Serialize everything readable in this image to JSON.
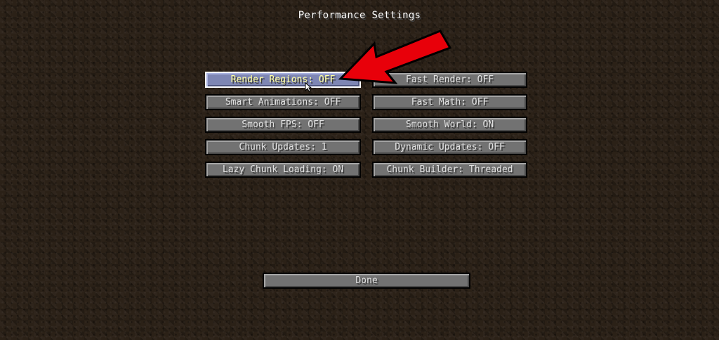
{
  "screen": {
    "title": "Performance Settings"
  },
  "options": {
    "render_regions": "Render Regions: OFF",
    "fast_render": "Fast Render: OFF",
    "smart_animations": "Smart Animations: OFF",
    "fast_math": "Fast Math: OFF",
    "smooth_fps": "Smooth FPS: OFF",
    "smooth_world": "Smooth World: ON",
    "chunk_updates": "Chunk Updates: 1",
    "dynamic_updates": "Dynamic Updates: OFF",
    "lazy_chunk_loading": "Lazy Chunk Loading: ON",
    "chunk_builder": "Chunk Builder: Threaded"
  },
  "footer": {
    "done_label": "Done"
  },
  "annotation": {
    "arrow_color": "#e8000a",
    "icon": "arrow-annotation-icon"
  },
  "colors": {
    "button_face": "#727272",
    "button_hover_face": "#7e86b4",
    "hover_text": "#ffffa0",
    "title_text": "#ffffff"
  }
}
